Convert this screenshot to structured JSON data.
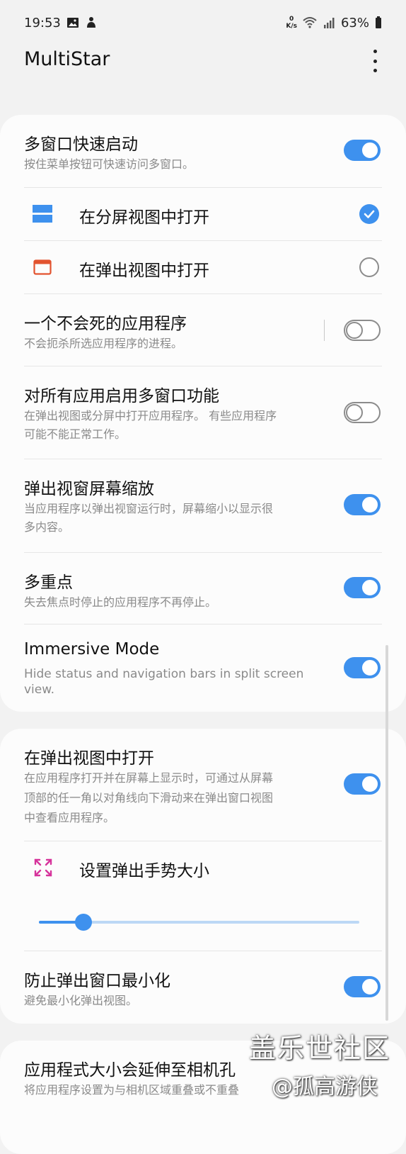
{
  "status_bar": {
    "time": "19:53",
    "net_speed_top": "0",
    "net_speed_unit": "K/s",
    "battery": "63%"
  },
  "app_bar": {
    "title": "MultiStar"
  },
  "card1": {
    "quick_launch": {
      "title": "多窗口快速启动",
      "subtitle": "按住菜单按钮可快速访问多窗口。",
      "toggle": "on"
    },
    "open_split": {
      "label": "在分屏视图中打开",
      "selected": true
    },
    "open_popup": {
      "label": "在弹出视图中打开",
      "selected": false
    },
    "undying_app": {
      "title": "一个不会死的应用程序",
      "subtitle": "不会扼杀所选应用程序的进程。",
      "toggle": "off"
    },
    "enable_all": {
      "title": "对所有应用启用多窗口功能",
      "subtitle_1": "在弹出视图或分屏中打开应用程序。 有些应用程序",
      "subtitle_2": "可能不能正常工作。",
      "toggle": "off"
    },
    "popup_zoom": {
      "title": "弹出视窗屏幕缩放",
      "subtitle_1": "当应用程序以弹出视窗运行时，屏幕缩小以显示很",
      "subtitle_2": "多内容。",
      "toggle": "on"
    },
    "multi_focus": {
      "title": "多重点",
      "subtitle": "失去焦点时停止的应用程序不再停止。",
      "toggle": "on"
    },
    "immersive": {
      "title": "Immersive Mode",
      "subtitle_1": "Hide status and navigation bars in split screen",
      "subtitle_2": "view.",
      "toggle": "on"
    }
  },
  "card2": {
    "open_in_popup": {
      "title": "在弹出视图中打开",
      "subtitle_1": "在应用程序打开并在屏幕上显示时，可通过从屏幕",
      "subtitle_2": "顶部的任一角以对角线向下滑动来在弹出窗口视图",
      "subtitle_3": "中查看应用程序。",
      "toggle": "on"
    },
    "gesture_size": {
      "label": "设置弹出手势大小",
      "slider_value": 0.14
    },
    "prevent_minimize": {
      "title": "防止弹出窗口最小化",
      "subtitle": "避免最小化弹出视图。",
      "toggle": "on"
    }
  },
  "card3": {
    "camera_cutout": {
      "title": "应用程式大小会延伸至相机孔",
      "subtitle": "将应用程序设置为与相机区域重叠或不重叠"
    }
  },
  "watermark": {
    "line1": "盖乐世社区",
    "line2": "@孤高游侠"
  },
  "colors": {
    "accent": "#3e91ee",
    "popup_icon": "#e2532f",
    "gesture_icon": "#d6339b"
  }
}
